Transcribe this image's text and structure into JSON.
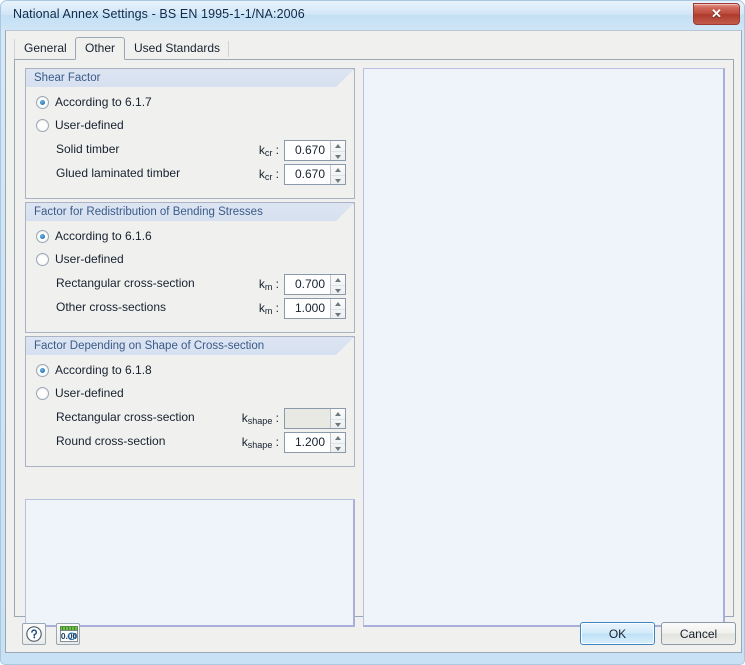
{
  "window": {
    "title": "National Annex Settings - BS EN 1995-1-1/NA:2006",
    "close_label": "✕"
  },
  "tabs": [
    {
      "label": "General",
      "active": false
    },
    {
      "label": "Other",
      "active": true
    },
    {
      "label": "Used Standards",
      "active": false
    }
  ],
  "groups": [
    {
      "title": "Shear Factor",
      "options": [
        {
          "label": "According to 6.1.7",
          "checked": true
        },
        {
          "label": "User-defined",
          "checked": false
        }
      ],
      "fields": [
        {
          "label": "Solid timber",
          "symbol": "k",
          "subscript": "cr",
          "colon": ":",
          "value": "0.670",
          "disabled": false
        },
        {
          "label": "Glued laminated timber",
          "symbol": "k",
          "subscript": "cr",
          "colon": ":",
          "value": "0.670",
          "disabled": false
        }
      ]
    },
    {
      "title": "Factor for Redistribution of Bending Stresses",
      "options": [
        {
          "label": "According to 6.1.6",
          "checked": true
        },
        {
          "label": "User-defined",
          "checked": false
        }
      ],
      "fields": [
        {
          "label": "Rectangular cross-section",
          "symbol": "k",
          "subscript": "m",
          "colon": ":",
          "value": "0.700",
          "disabled": false
        },
        {
          "label": "Other cross-sections",
          "symbol": "k",
          "subscript": "m",
          "colon": ":",
          "value": "1.000",
          "disabled": false
        }
      ]
    },
    {
      "title": "Factor Depending on Shape of Cross-section",
      "options": [
        {
          "label": "According to 6.1.8",
          "checked": true
        },
        {
          "label": "User-defined",
          "checked": false
        }
      ],
      "fields": [
        {
          "label": "Rectangular cross-section",
          "symbol": "k",
          "subscript": "shape",
          "colon": ":",
          "value": "",
          "disabled": true
        },
        {
          "label": "Round cross-section",
          "symbol": "k",
          "subscript": "shape",
          "colon": ":",
          "value": "1.200",
          "disabled": false
        }
      ]
    }
  ],
  "toolbar": {
    "help_icon": "help-question-icon",
    "number_format_icon": "number-format-icon",
    "number_format_text": "0.00"
  },
  "buttons": {
    "ok": "OK",
    "cancel": "Cancel"
  },
  "colors": {
    "title_text": "#0f2a4a",
    "group_title": "#3a5a88",
    "radio_dot": "#2b7fc4",
    "close_red": "#bb4a3b",
    "primary_border": "#3c86c4",
    "panel_bg": "#eff3fa"
  }
}
